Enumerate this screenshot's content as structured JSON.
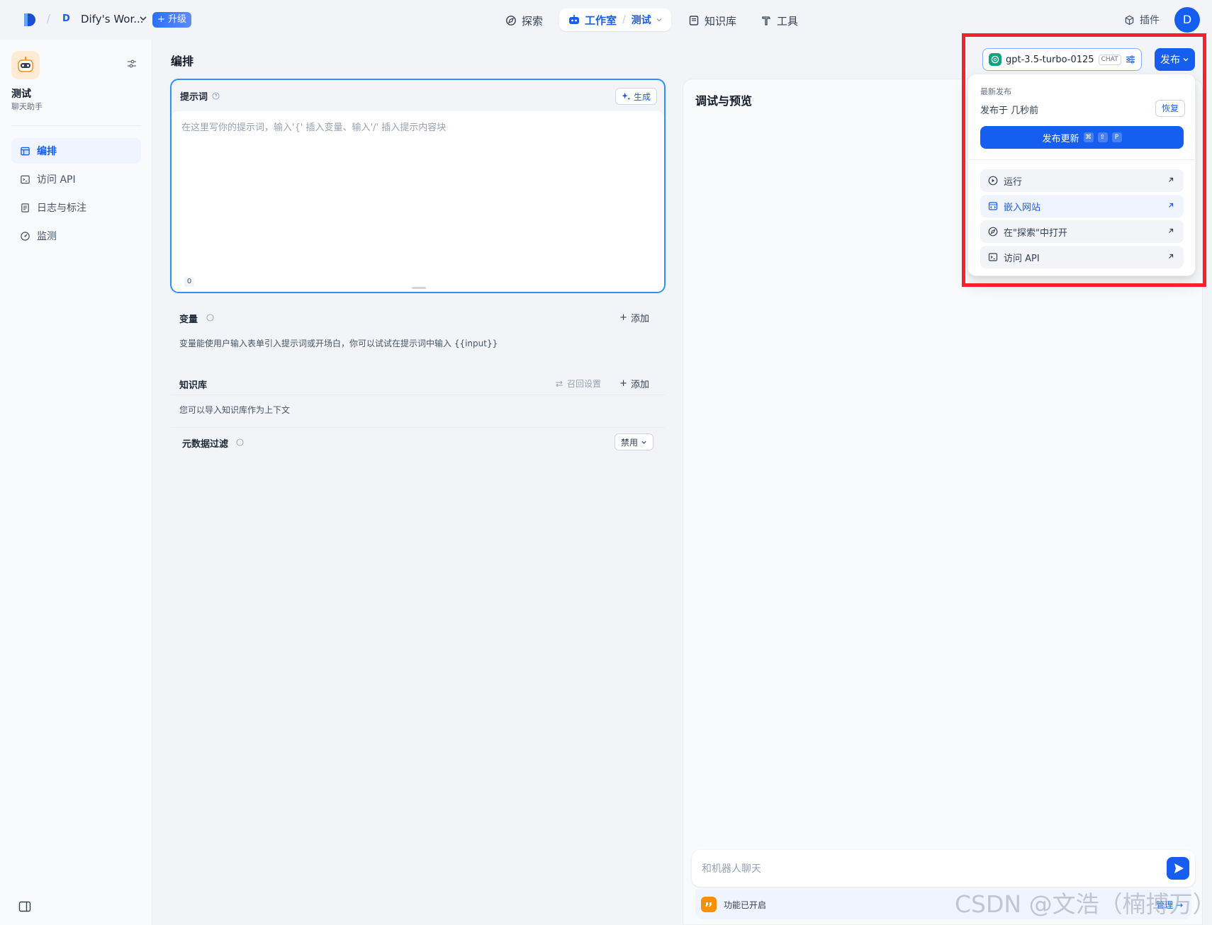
{
  "topbar": {
    "workspace_badge": "D",
    "workspace_name": "Dify's Wor...",
    "upgrade_label": "+ 升级",
    "nav": {
      "explore": "探索",
      "studio": "工作室",
      "current_app": "测试",
      "knowledge": "知识库",
      "tools": "工具"
    },
    "plugins": "插件",
    "user_initial": "D"
  },
  "sidebar": {
    "app_name": "测试",
    "app_type": "聊天助手",
    "items": [
      {
        "label": "编排",
        "icon": "layout-icon",
        "active": true
      },
      {
        "label": "访问 API",
        "icon": "terminal-icon",
        "active": false
      },
      {
        "label": "日志与标注",
        "icon": "file-list-icon",
        "active": false
      },
      {
        "label": "监测",
        "icon": "dashboard-icon",
        "active": false
      }
    ]
  },
  "editor": {
    "title": "编排",
    "prompt": {
      "label": "提示词",
      "generate_label": "生成",
      "placeholder": "在这里写你的提示词，输入'{' 插入变量、输入'/' 插入提示内容块",
      "char_count": "0"
    },
    "variables": {
      "label": "变量",
      "add_label": "添加",
      "description": "变量能使用户输入表单引入提示词或开场白，你可以试试在提示词中输入 {{input}}"
    },
    "knowledge": {
      "label": "知识库",
      "recall_label": "召回设置",
      "add_label": "添加",
      "description": "您可以导入知识库作为上下文",
      "metadata_label": "元数据过滤",
      "metadata_value": "禁用"
    }
  },
  "preview": {
    "title": "调试与预览",
    "chat_placeholder": "和机器人聊天",
    "feature_text": "功能已开启",
    "manage_label": "管理"
  },
  "model": {
    "name": "gpt-3.5-turbo-0125",
    "tag": "CHAT"
  },
  "publish": {
    "button_label": "发布",
    "latest_label": "最新发布",
    "status": "发布于 几秒前",
    "restore_label": "恢复",
    "update_label": "发布更新",
    "shortcut": [
      "⌘",
      "⇧",
      "P"
    ],
    "actions": [
      {
        "label": "运行",
        "icon": "play-circle-icon"
      },
      {
        "label": "嵌入网站",
        "icon": "embed-window-icon"
      },
      {
        "label": "在\"探索\"中打开",
        "icon": "compass-icon"
      },
      {
        "label": "访问 API",
        "icon": "terminal-icon"
      }
    ]
  },
  "watermark": "CSDN @文浩（楠搏万）",
  "colors": {
    "primary": "#155eef",
    "annotation_border": "#f5222d",
    "openai_green": "#10a37f",
    "feature_orange": "#f79009"
  }
}
